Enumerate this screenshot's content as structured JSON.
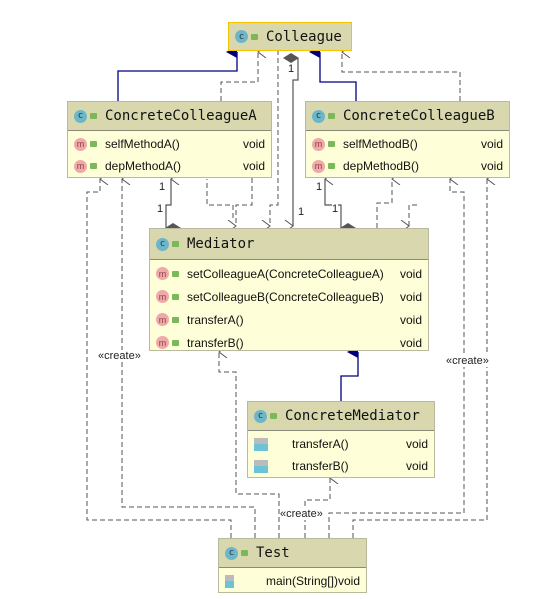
{
  "classes": {
    "colleague": {
      "name": "Colleague"
    },
    "cca": {
      "name": "ConcreteColleagueA",
      "methods": [
        {
          "name": "selfMethodA()",
          "type": "void"
        },
        {
          "name": "depMethodA()",
          "type": "void"
        }
      ]
    },
    "ccb": {
      "name": "ConcreteColleagueB",
      "methods": [
        {
          "name": "selfMethodB()",
          "type": "void"
        },
        {
          "name": "depMethodB()",
          "type": "void"
        }
      ]
    },
    "mediator": {
      "name": "Mediator",
      "methods": [
        {
          "name": "setColleagueA(ConcreteColleagueA)",
          "type": "void"
        },
        {
          "name": "setColleagueB(ConcreteColleagueB)",
          "type": "void"
        },
        {
          "name": "transferA()",
          "type": "void"
        },
        {
          "name": "transferB()",
          "type": "void"
        }
      ]
    },
    "cm": {
      "name": "ConcreteMediator",
      "methods": [
        {
          "name": "transferA()",
          "type": "void"
        },
        {
          "name": "transferB()",
          "type": "void"
        }
      ]
    },
    "test": {
      "name": "Test",
      "methods": [
        {
          "name": "main(String[])",
          "type": "void"
        }
      ]
    }
  },
  "labels": {
    "create": "«create»",
    "one": "1"
  },
  "colors": {
    "inherit": "#00007f",
    "dep": "#555555",
    "header": "#d8d7ae",
    "body": "#fefed8",
    "selected": "#f5c400"
  }
}
